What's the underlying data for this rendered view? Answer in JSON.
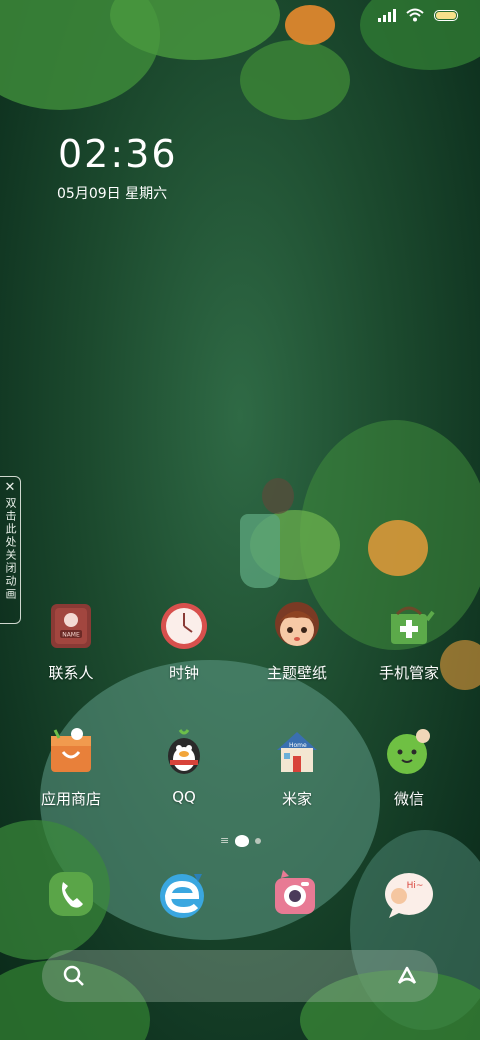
{
  "status": {
    "battery_color": "#f7e08a"
  },
  "clock": {
    "time": "02:36",
    "date": "05月09日 星期六"
  },
  "hint": {
    "text": "双击此处关闭动画"
  },
  "apps": {
    "contacts": "联系人",
    "clock": "时钟",
    "themes": "主题壁纸",
    "security": "手机管家",
    "store": "应用商店",
    "qq": "QQ",
    "mijia": "米家",
    "wechat": "微信"
  },
  "dock": {
    "phone": "phone-icon",
    "browser": "browser-icon",
    "camera": "camera-icon",
    "messages": "messages-icon"
  },
  "icons": {
    "contacts_tag": "NAME",
    "messages_bubble": "Hi~",
    "store_tag": "Home"
  }
}
